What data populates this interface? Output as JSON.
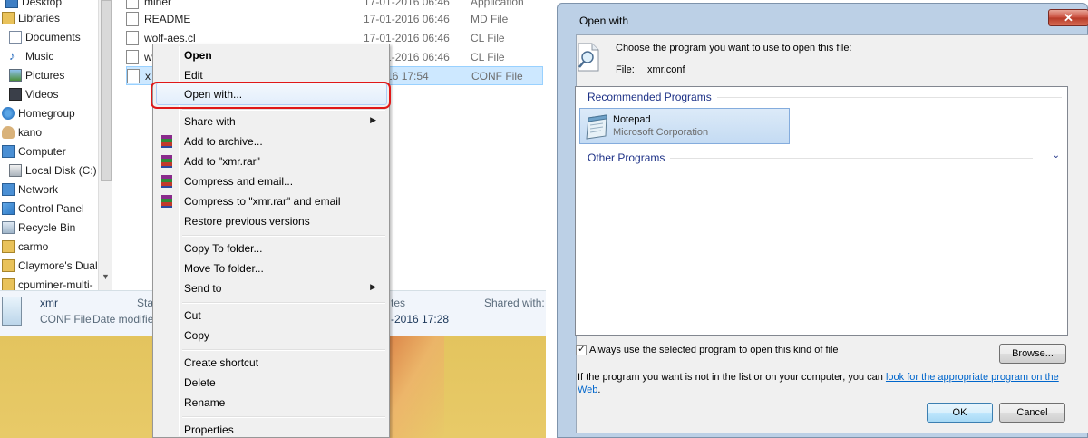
{
  "explorer": {
    "nav_items": [
      "Desktop",
      "Libraries",
      "Documents",
      "Music",
      "Pictures",
      "Videos",
      "Homegroup",
      "kano",
      "Computer",
      "Local Disk (C:)",
      "Network",
      "Control Panel",
      "Recycle Bin",
      "carmo",
      "Claymore's Dual",
      "cpuminer-multi-"
    ],
    "files": [
      {
        "name": "miner",
        "date": "17-01-2016 06:46",
        "type": "Application"
      },
      {
        "name": "README",
        "date": "17-01-2016 06:46",
        "type": "MD File"
      },
      {
        "name": "wolf-aes.cl",
        "date": "17-01-2016 06:46",
        "type": "CL File"
      },
      {
        "name": "w",
        "date": "17-01-2016 06:46",
        "type": "CL File"
      },
      {
        "name": "x",
        "date": "7-2016 17:54",
        "type": "CONF File"
      }
    ],
    "details": {
      "name": "xmr",
      "type": "CONF File",
      "date_label": "Date modifie",
      "state_label": "Sta",
      "dates_label": "tes",
      "date_value": "-2016 17:28",
      "shared_label": "Shared with:"
    }
  },
  "context_menu": {
    "items": [
      "Open",
      "Edit",
      "Open with...",
      "Share with",
      "Add to archive...",
      "Add to \"xmr.rar\"",
      "Compress and email...",
      "Compress to \"xmr.rar\" and email",
      "Restore previous versions",
      "Copy To folder...",
      "Move To folder...",
      "Send to",
      "Cut",
      "Copy",
      "Create shortcut",
      "Delete",
      "Rename",
      "Properties"
    ]
  },
  "dialog": {
    "title": "Open with",
    "close_label": "✕",
    "instruction": "Choose the program you want to use to open this file:",
    "file_label": "File:",
    "file_name": "xmr.conf",
    "recommended_heading": "Recommended Programs",
    "program_name": "Notepad",
    "program_vendor": "Microsoft Corporation",
    "other_heading": "Other Programs",
    "always_use_label": "Always use the selected program to open this kind of file",
    "always_use_checked": true,
    "browse_label": "Browse...",
    "footer_text": "If the program you want is not in the list or on your computer, you can ",
    "footer_link_a": "look for the appropriate program on the",
    "footer_link_b": "Web",
    "footer_end": ".",
    "ok_label": "OK",
    "cancel_label": "Cancel"
  },
  "colors": {
    "highlight_ring": "#e01818",
    "selection": "#cde8ff",
    "link": "#0066cc",
    "group_heading": "#1e3287"
  }
}
